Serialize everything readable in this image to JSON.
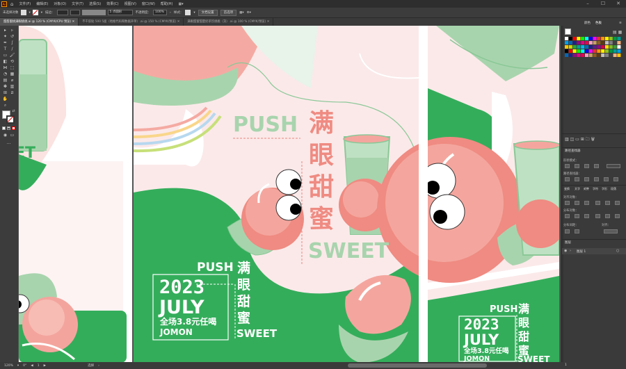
{
  "app": {
    "logo": "Ai"
  },
  "menu": [
    "文件(F)",
    "编辑(E)",
    "对象(O)",
    "文字(T)",
    "选择(S)",
    "效果(C)",
    "视图(V)",
    "窗口(W)",
    "帮助(H)"
  ],
  "control": {
    "selection": "未选择对象",
    "stroke_label": "描边：",
    "opacity_label": "不透明度：",
    "opacity": "100%",
    "style_label": "样式：",
    "stroke_preset": "5 点圆形",
    "btn_doc": "文档设置",
    "btn_pref": "首选项"
  },
  "tabs": [
    "甜甜蜜桃满眼桃桃.ai @ 120 % (CMYK/CPU 预览)",
    "不干胶贴 500 5面（地推代码和数据开单）.ai @ 150 % (CMYK/预览)",
    "满眼甜蜜甜夏奶茶饮桃桃（货）.ai @ 100 % (CMYK/预览)"
  ],
  "artwork": {
    "push": "PUSH",
    "title": "满眼甜蜜",
    "sweet": "SWEET",
    "year": "2023",
    "month": "JULY",
    "promo": "全场3.8元任喝",
    "brand": "JOMON"
  },
  "status": {
    "zoom": "120%",
    "angle": "0°",
    "page": "1",
    "tool": "选择"
  },
  "panels": {
    "color": {
      "tabs": [
        "颜色",
        "色板"
      ]
    },
    "pathfinder": {
      "title": "路径查找器",
      "shape_modes": "形状模式：",
      "pathfinders": "路径查找器："
    },
    "align": {
      "tabs": [
        "变换",
        "文字",
        "对齐",
        "字符",
        "字形",
        "段落"
      ],
      "align_objects": "对齐对象：",
      "distribute_objects": "分布对象：",
      "distribute_spacing": "分布间距：",
      "align_to": "对齐："
    },
    "layers": {
      "title": "图层",
      "layer1": "图层 1",
      "layer_count": "1"
    }
  },
  "colors": {
    "green": "#34ad5b",
    "pink": "#f9e5e5",
    "peach": "#ef8b82",
    "mint": "#a8d4ad",
    "text_pink": "#e8857b"
  }
}
